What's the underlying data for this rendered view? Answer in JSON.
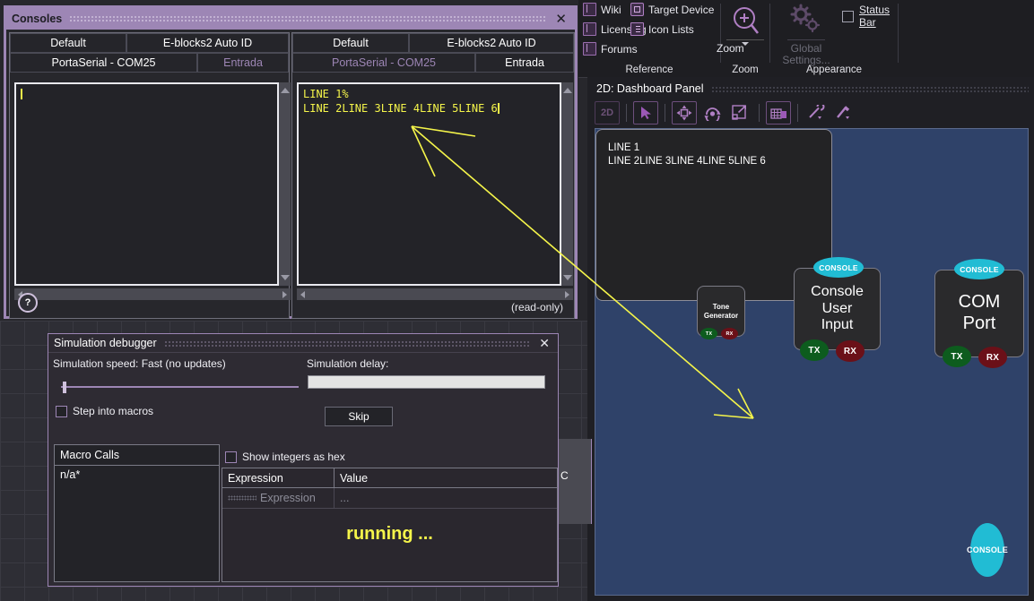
{
  "ribbon": {
    "groups": [
      {
        "caption": "Reference"
      },
      {
        "caption": "Zoom"
      },
      {
        "caption": "Appearance"
      }
    ],
    "reference": {
      "wiki": "Wiki",
      "licensing": "Licensing",
      "forums": "Forums",
      "target_device": "Target Device",
      "icon_lists": "Icon Lists"
    },
    "zoom": {
      "label": "Zoom"
    },
    "appearance": {
      "global_settings": "Global Settings...",
      "status_bar": "Status Bar"
    },
    "accent": "#9d86b5"
  },
  "dashboard": {
    "title": "2D: Dashboard Panel",
    "toolbar": [
      "2d-button",
      "select-tool",
      "move-tool",
      "rotate-tool",
      "scale-tool",
      "snap-grid-tool",
      "wrench-tool",
      "brush-tool"
    ],
    "canvas_color": "#2f4269",
    "widgets": [
      {
        "name": "Tone Generator",
        "tx": "TX",
        "rx": "RX"
      },
      {
        "name": "Console User Input",
        "badge": "CONSOLE",
        "tx": "TX",
        "rx": "RX"
      },
      {
        "name": "COM Port",
        "badge": "CONSOLE",
        "tx": "TX",
        "rx": "RX"
      }
    ],
    "console_widget": {
      "badge": "CONSOLE",
      "line1": "LINE 1",
      "line2": "LINE 2LINE 3LINE 4LINE 5LINE 6"
    }
  },
  "consoles": {
    "title": "Consoles",
    "close": "✕",
    "help": "?",
    "readonly": "(read-only)",
    "left": {
      "tabs_top": [
        "Default",
        "E-blocks2 Auto ID"
      ],
      "tabs_bottom": [
        "PortaSerial - COM25",
        "Entrada"
      ],
      "active_bottom": "PortaSerial - COM25",
      "text": ""
    },
    "right": {
      "tabs_top": [
        "Default",
        "E-blocks2 Auto ID"
      ],
      "tabs_bottom": [
        "PortaSerial - COM25",
        "Entrada"
      ],
      "active_bottom": "Entrada",
      "line1": "LINE 1%",
      "line2": "LINE 2LINE 3LINE 4LINE 5LINE 6"
    }
  },
  "sim_debugger": {
    "title": "Simulation debugger",
    "close": "✕",
    "speed_label": "Simulation speed: Fast (no updates)",
    "delay_label": "Simulation delay:",
    "delay_value": "",
    "step_into_macros": "Step into macros",
    "skip": "Skip",
    "show_hex": "Show integers as hex",
    "macro_calls_header": "Macro Calls",
    "macro_calls_row": "n/a*",
    "expr_headers": [
      "Expression",
      "Value"
    ],
    "expr_rows": [
      [
        "Expression",
        "..."
      ]
    ],
    "status": "running ...",
    "status_color": "#f5f54a",
    "clipped_text": "C"
  }
}
